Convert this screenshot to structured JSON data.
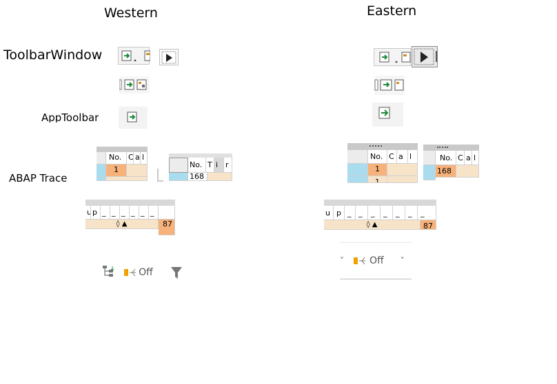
{
  "headers": {
    "western": "Western",
    "eastern": "Eastern"
  },
  "rows": {
    "toolbar_window": "ToolbarWindow",
    "app_toolbar": "AppToolbar",
    "abap_trace": "ABAP Trace"
  },
  "grid_western_1": {
    "cols": [
      "No.",
      "C",
      "a",
      "l"
    ],
    "value": "1"
  },
  "grid_western_2": {
    "cols": [
      "No.",
      "T",
      "i",
      "r"
    ],
    "value": "168"
  },
  "grid_eastern_1": {
    "cols": [
      "No.",
      "C",
      "a",
      "l"
    ],
    "value": "1",
    "value2": "1"
  },
  "grid_eastern_2": {
    "cols": [
      "No.",
      "C",
      "a",
      "l"
    ],
    "value": "168"
  },
  "header_strip_western": {
    "cols": [
      "u",
      "p",
      "_",
      "_",
      "_",
      "_",
      "_",
      "_"
    ],
    "glyphs": "◊ ▲",
    "value": "87"
  },
  "header_strip_eastern": {
    "cols": [
      "u",
      "p",
      "_",
      "_",
      "_",
      "_",
      "_",
      "_",
      "_"
    ],
    "glyphs": "◊ ▲",
    "value": "87"
  },
  "toggle_western": {
    "label": "Off"
  },
  "toggle_eastern": {
    "label": "Off"
  },
  "colors": {
    "cyan": "#a8dcee",
    "peach": "#f7e3c8",
    "orange": "#f6b27a",
    "green": "#1a8a3a"
  }
}
